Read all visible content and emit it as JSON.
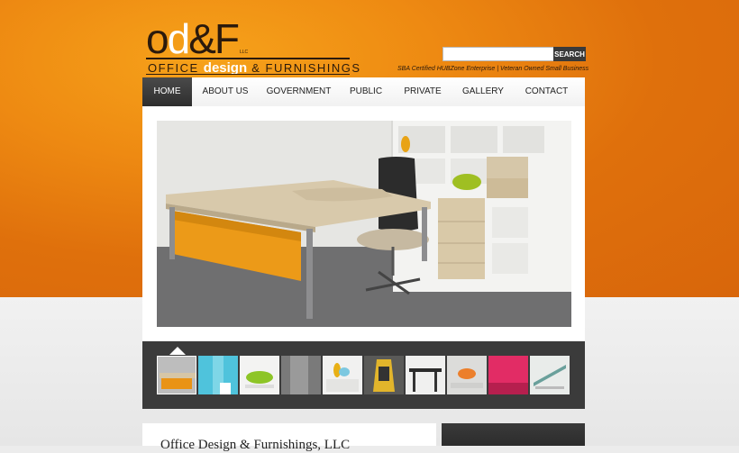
{
  "logo": {
    "mark_left": "o",
    "mark_d": "d",
    "mark_right": "&F",
    "llc": "LLC",
    "tag_left": "OFFICE ",
    "tag_design": "design",
    "tag_right": " & FURNISHINGS"
  },
  "search": {
    "placeholder": "",
    "button_label": "SEARCH"
  },
  "certification": "SBA Certified HUBZone Enterprise | Veteran Owned Small Business",
  "nav": {
    "items": [
      {
        "label": "HOME",
        "active": true
      },
      {
        "label": "ABOUT US"
      },
      {
        "label": "GOVERNMENT"
      },
      {
        "label": "PUBLIC"
      },
      {
        "label": "PRIVATE"
      },
      {
        "label": "GALLERY"
      },
      {
        "label": "CONTACT"
      }
    ]
  },
  "content": {
    "title": "Office Design & Furnishings, LLC"
  },
  "colors": {
    "brand_orange": "#e37a0e",
    "nav_active": "#333333",
    "strip": "#3b3b3b"
  }
}
